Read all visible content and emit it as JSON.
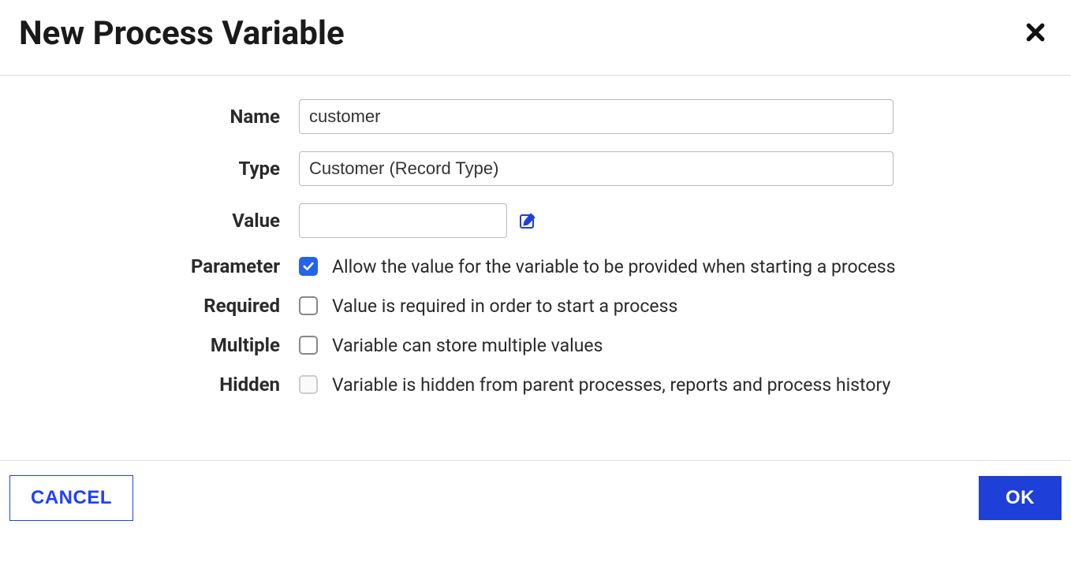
{
  "dialog": {
    "title": "New Process Variable"
  },
  "form": {
    "name": {
      "label": "Name",
      "value": "customer"
    },
    "type": {
      "label": "Type",
      "value": "Customer (Record Type)"
    },
    "value": {
      "label": "Value",
      "value": ""
    },
    "parameter": {
      "label": "Parameter",
      "checked": true,
      "text": "Allow the value for the variable to be provided when starting a process"
    },
    "required": {
      "label": "Required",
      "checked": false,
      "text": "Value is required in order to start a process"
    },
    "multiple": {
      "label": "Multiple",
      "checked": false,
      "text": "Variable can store multiple values"
    },
    "hidden": {
      "label": "Hidden",
      "checked": false,
      "disabled": true,
      "text": "Variable is hidden from parent processes, reports and process history"
    }
  },
  "footer": {
    "cancel": "CANCEL",
    "ok": "OK"
  }
}
